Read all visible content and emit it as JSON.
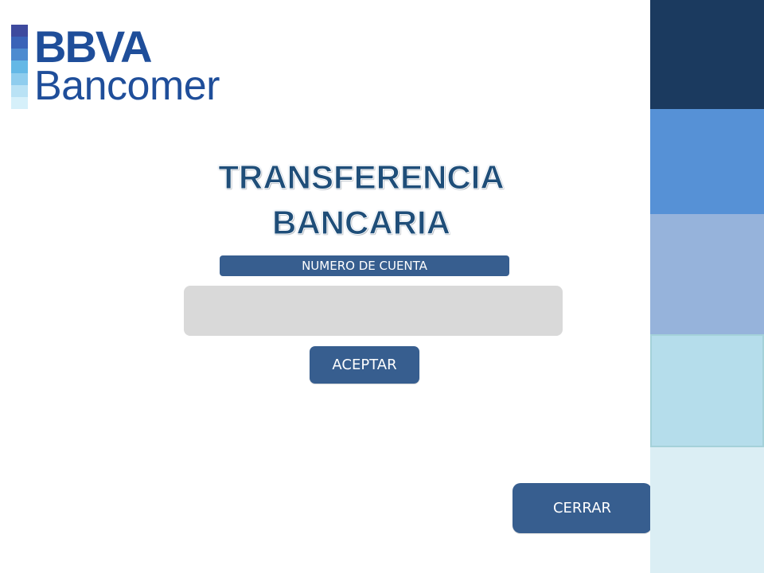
{
  "logo": {
    "brand_top": "BBVA",
    "brand_bottom": "Bancomer",
    "bar_colors": [
      "#3e4a9e",
      "#3a63b8",
      "#4d8bd0",
      "#64b8e6",
      "#8fcdee",
      "#b9e2f5",
      "#d6f0fa"
    ]
  },
  "title": {
    "line1": "TRANSFERENCIA",
    "line2": "BANCARIA"
  },
  "form": {
    "account_label": "NUMERO DE CUENTA",
    "account_value": "",
    "accept_label": "ACEPTAR"
  },
  "footer": {
    "close_label": "CERRAR"
  },
  "colors": {
    "primary": "#375e8f",
    "title": "#1f4e79",
    "input_bg": "#d9d9d9",
    "side_panels": [
      "#1b3a5f",
      "#5691d6",
      "#96b3db",
      "#b5ddeb",
      "#dbeef4"
    ]
  }
}
